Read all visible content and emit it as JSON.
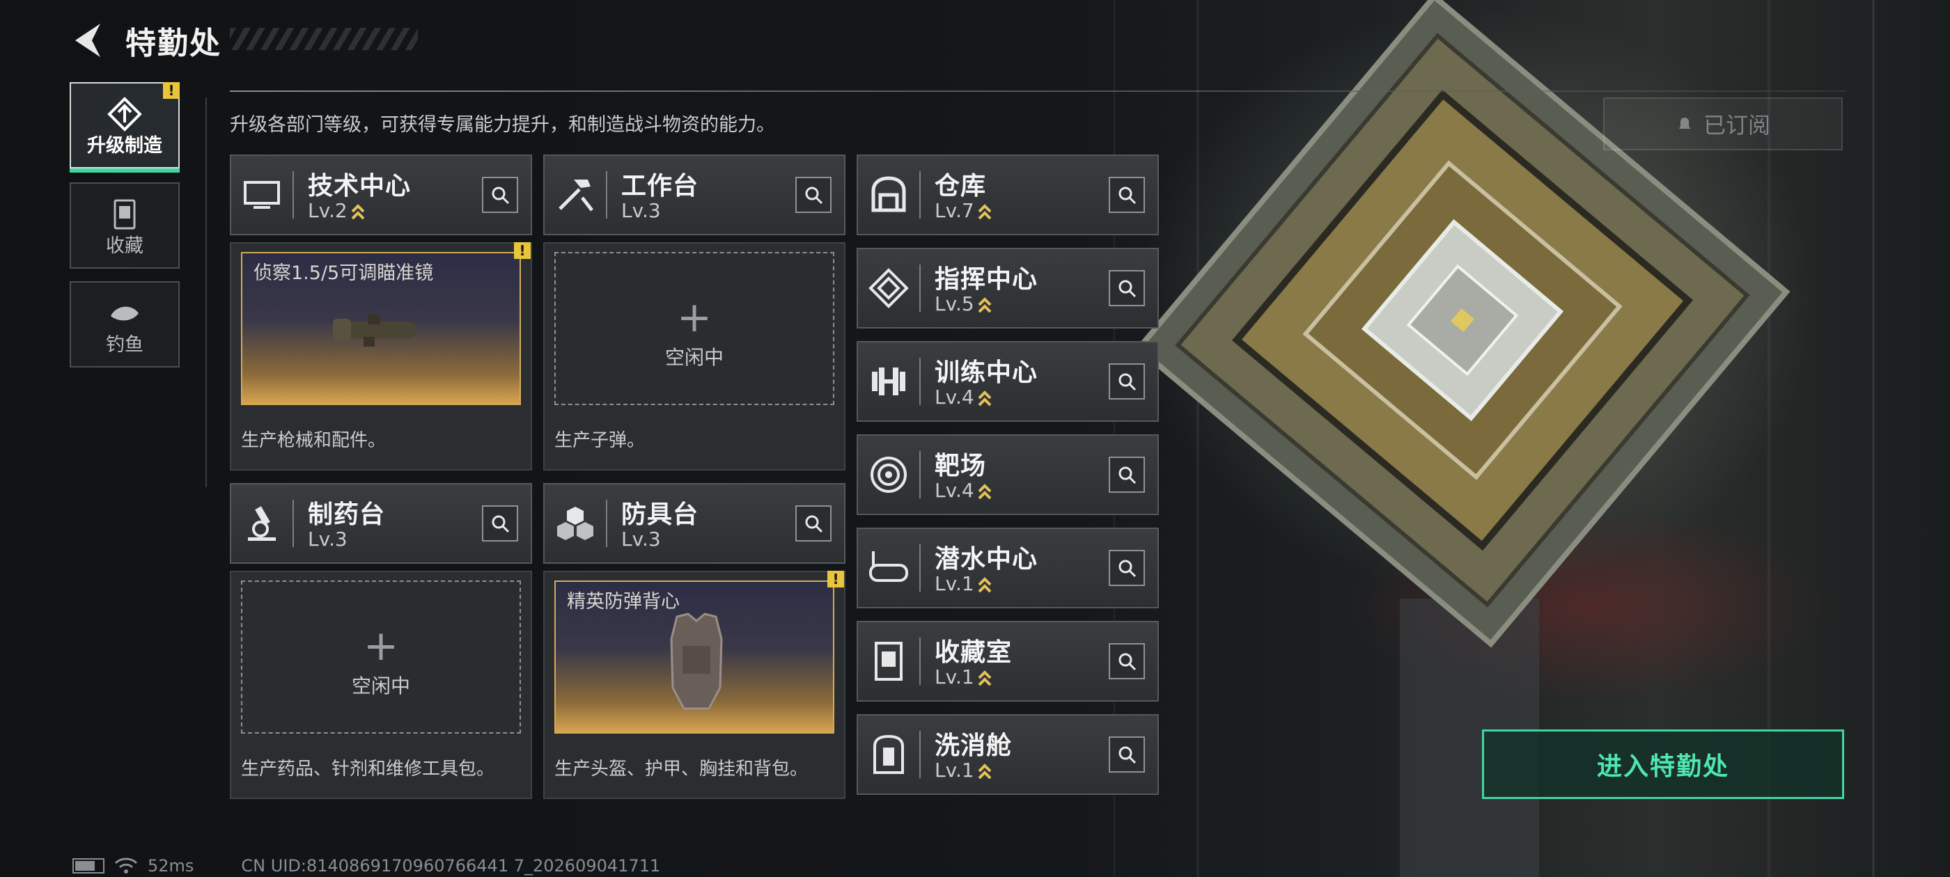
{
  "header": {
    "title": "特勤处",
    "back_icon": "back-arrow-icon"
  },
  "sidebar": {
    "items": [
      {
        "label": "升级制造",
        "icon": "upgrade-icon",
        "active": true,
        "alert": "!"
      },
      {
        "label": "收藏",
        "icon": "collection-icon",
        "active": false
      },
      {
        "label": "钓鱼",
        "icon": "fish-icon",
        "active": false
      }
    ]
  },
  "main": {
    "subtitle": "升级各部门等级，可获得专属能力提升，和制造战斗物资的能力。",
    "subscribed_label": "已订阅"
  },
  "production": [
    {
      "name": "技术中心",
      "level": "Lv.2",
      "icon": "monitor-icon",
      "slot_state": "busy",
      "item": "侦察1.5/5可调瞄准镜",
      "item_icon": "scope-icon",
      "alert": "!",
      "desc": "生产枪械和配件。"
    },
    {
      "name": "工作台",
      "level": "Lv.3",
      "icon": "tools-icon",
      "slot_state": "idle",
      "idle_label": "空闲中",
      "desc": "生产子弹。"
    },
    {
      "name": "制药台",
      "level": "Lv.3",
      "icon": "microscope-icon",
      "slot_state": "idle",
      "idle_label": "空闲中",
      "desc": "生产药品、针剂和维修工具包。"
    },
    {
      "name": "防具台",
      "level": "Lv.3",
      "icon": "boxes-icon",
      "slot_state": "busy",
      "item": "精英防弹背心",
      "item_icon": "vest-icon",
      "alert": "!",
      "desc": "生产头盔、护甲、胸挂和背包。"
    }
  ],
  "facilities": [
    {
      "name": "仓库",
      "level": "Lv.7",
      "icon": "warehouse-icon"
    },
    {
      "name": "指挥中心",
      "level": "Lv.5",
      "icon": "chip-icon"
    },
    {
      "name": "训练中心",
      "level": "Lv.4",
      "icon": "dumbbell-icon"
    },
    {
      "name": "靶场",
      "level": "Lv.4",
      "icon": "target-icon"
    },
    {
      "name": "潜水中心",
      "level": "Lv.1",
      "icon": "diving-mask-icon"
    },
    {
      "name": "收藏室",
      "level": "Lv.1",
      "icon": "display-case-icon"
    },
    {
      "name": "洗消舱",
      "level": "Lv.1",
      "icon": "decon-chamber-icon"
    }
  ],
  "enter_button": "进入特勤处",
  "footer": {
    "ping": "52ms",
    "uid": "CN UID:8140869170960766441 7_202609041711"
  },
  "colors": {
    "accent_green": "#3fd7a0",
    "warn_yellow": "#e9c53b",
    "upgrade_chevron": "#e3c25a"
  }
}
